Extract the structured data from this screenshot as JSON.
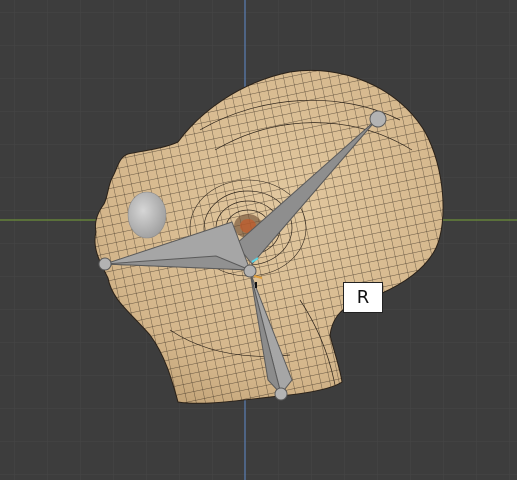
{
  "viewport": {
    "background": "#3d3d3d",
    "grid_color": "#474747",
    "x_axis_color": "#6d8f3a",
    "y_axis_color": "#5a7fb5"
  },
  "mesh": {
    "skin_color": "#d8bd93",
    "wire_color": "#2a2118",
    "eyeball_color": "#b9b9b9"
  },
  "armature": {
    "bone_color": "#a6a6a6",
    "bone_outline": "#5a5a5a",
    "joint_color": "#b3b3b3"
  },
  "transform_mode": {
    "label": "R"
  }
}
